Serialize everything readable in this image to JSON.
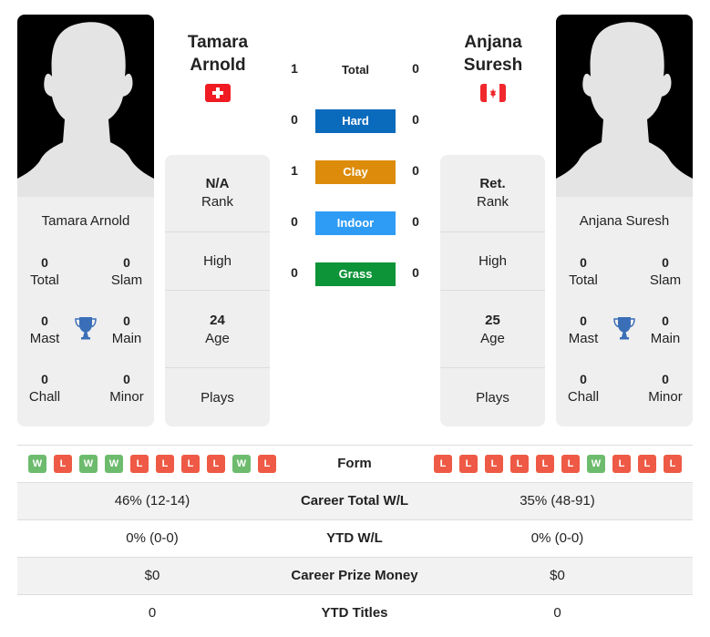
{
  "player1": {
    "name_line1": "Tamara",
    "name_line2": "Arnold",
    "full_name": "Tamara Arnold",
    "flag": "switzerland-flag",
    "titles": {
      "total": {
        "value": "0",
        "label": "Total"
      },
      "slam": {
        "value": "0",
        "label": "Slam"
      },
      "mast": {
        "value": "0",
        "label": "Mast"
      },
      "main": {
        "value": "0",
        "label": "Main"
      },
      "chall": {
        "value": "0",
        "label": "Chall"
      },
      "minor": {
        "value": "0",
        "label": "Minor"
      }
    },
    "info": {
      "rank_value": "N/A",
      "rank_label": "Rank",
      "high_label": "High",
      "age_value": "24",
      "age_label": "Age",
      "plays_label": "Plays"
    },
    "form": [
      "W",
      "L",
      "W",
      "W",
      "L",
      "L",
      "L",
      "L",
      "W",
      "L"
    ],
    "career_total_wl": "46% (12-14)",
    "ytd_wl": "0% (0-0)",
    "career_prize_money": "$0",
    "ytd_titles": "0"
  },
  "player2": {
    "name_line1": "Anjana",
    "name_line2": "Suresh",
    "full_name": "Anjana Suresh",
    "flag": "canada-flag",
    "titles": {
      "total": {
        "value": "0",
        "label": "Total"
      },
      "slam": {
        "value": "0",
        "label": "Slam"
      },
      "mast": {
        "value": "0",
        "label": "Mast"
      },
      "main": {
        "value": "0",
        "label": "Main"
      },
      "chall": {
        "value": "0",
        "label": "Chall"
      },
      "minor": {
        "value": "0",
        "label": "Minor"
      }
    },
    "info": {
      "rank_value": "Ret.",
      "rank_label": "Rank",
      "high_label": "High",
      "age_value": "25",
      "age_label": "Age",
      "plays_label": "Plays"
    },
    "form": [
      "L",
      "L",
      "L",
      "L",
      "L",
      "L",
      "W",
      "L",
      "L",
      "L"
    ],
    "career_total_wl": "35% (48-91)",
    "ytd_wl": "0% (0-0)",
    "career_prize_money": "$0",
    "ytd_titles": "0"
  },
  "h2h": {
    "total": {
      "label": "Total",
      "p1": "1",
      "p2": "0"
    },
    "surfaces": [
      {
        "label": "Hard",
        "p1": "0",
        "p2": "0",
        "color": "#0a6bbd"
      },
      {
        "label": "Clay",
        "p1": "1",
        "p2": "0",
        "color": "#dc8c0a"
      },
      {
        "label": "Indoor",
        "p1": "0",
        "p2": "0",
        "color": "#2e9cf5"
      },
      {
        "label": "Grass",
        "p1": "0",
        "p2": "0",
        "color": "#0e9438"
      }
    ]
  },
  "table": {
    "form_label": "Form",
    "career_total_wl_label": "Career Total W/L",
    "ytd_wl_label": "YTD W/L",
    "career_prize_money_label": "Career Prize Money",
    "ytd_titles_label": "YTD Titles"
  },
  "colors": {
    "win": "#6dbb6d",
    "loss": "#ee5a45",
    "trophy": "#3a6fb8"
  }
}
